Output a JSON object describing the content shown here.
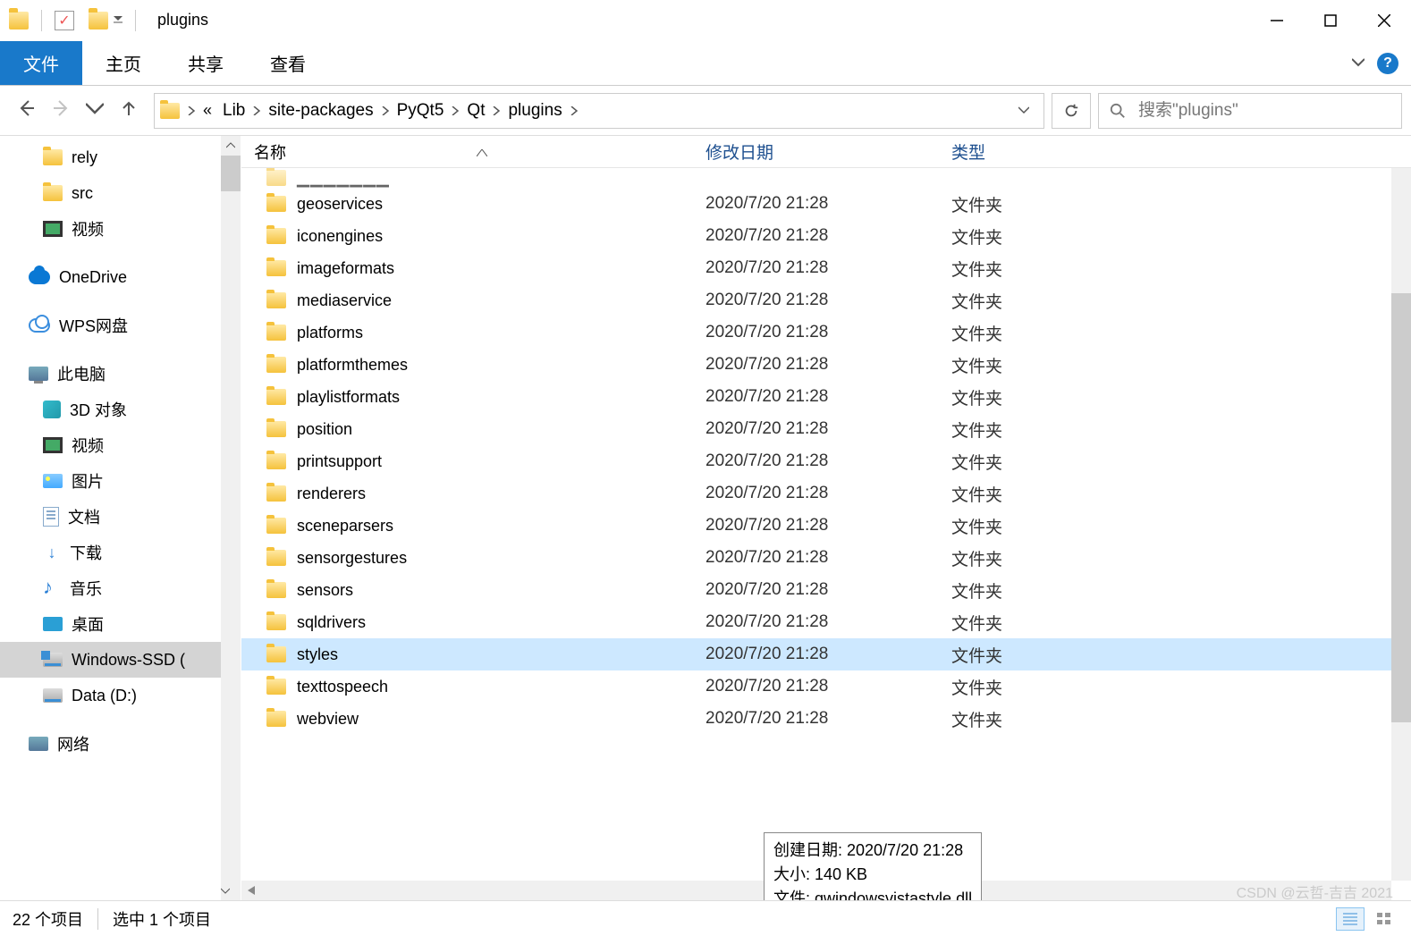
{
  "title": "plugins",
  "ribbon": {
    "file": "文件",
    "home": "主页",
    "share": "共享",
    "view": "查看"
  },
  "breadcrumb": [
    "Lib",
    "site-packages",
    "PyQt5",
    "Qt",
    "plugins"
  ],
  "search": {
    "placeholder": "搜索\"plugins\""
  },
  "columns": {
    "name": "名称",
    "date": "修改日期",
    "type": "类型"
  },
  "tree": [
    {
      "icon": "folder",
      "lvl": 2,
      "label": "rely"
    },
    {
      "icon": "folder",
      "lvl": 2,
      "label": "src"
    },
    {
      "icon": "video",
      "lvl": 2,
      "label": "视频"
    },
    {
      "icon": "onedrive",
      "lvl": 1,
      "label": "OneDrive",
      "gap": true
    },
    {
      "icon": "wps",
      "lvl": 1,
      "label": "WPS网盘",
      "gap": true
    },
    {
      "icon": "pc",
      "lvl": 1,
      "label": "此电脑",
      "gap": true
    },
    {
      "icon": "3d",
      "lvl": 2,
      "label": "3D 对象"
    },
    {
      "icon": "video",
      "lvl": 2,
      "label": "视频"
    },
    {
      "icon": "pic",
      "lvl": 2,
      "label": "图片"
    },
    {
      "icon": "doc",
      "lvl": 2,
      "label": "文档"
    },
    {
      "icon": "dl",
      "lvl": 2,
      "label": "下载"
    },
    {
      "icon": "music",
      "lvl": 2,
      "label": "音乐"
    },
    {
      "icon": "desk",
      "lvl": 2,
      "label": "桌面"
    },
    {
      "icon": "diskwin",
      "lvl": 2,
      "label": "Windows-SSD (",
      "selected": true
    },
    {
      "icon": "disk",
      "lvl": 2,
      "label": "Data (D:)"
    },
    {
      "icon": "net",
      "lvl": 1,
      "label": "网络",
      "gap": true
    }
  ],
  "files": [
    {
      "name": "geoservices",
      "date": "2020/7/20 21:28",
      "type": "文件夹"
    },
    {
      "name": "iconengines",
      "date": "2020/7/20 21:28",
      "type": "文件夹"
    },
    {
      "name": "imageformats",
      "date": "2020/7/20 21:28",
      "type": "文件夹"
    },
    {
      "name": "mediaservice",
      "date": "2020/7/20 21:28",
      "type": "文件夹"
    },
    {
      "name": "platforms",
      "date": "2020/7/20 21:28",
      "type": "文件夹"
    },
    {
      "name": "platformthemes",
      "date": "2020/7/20 21:28",
      "type": "文件夹"
    },
    {
      "name": "playlistformats",
      "date": "2020/7/20 21:28",
      "type": "文件夹"
    },
    {
      "name": "position",
      "date": "2020/7/20 21:28",
      "type": "文件夹"
    },
    {
      "name": "printsupport",
      "date": "2020/7/20 21:28",
      "type": "文件夹"
    },
    {
      "name": "renderers",
      "date": "2020/7/20 21:28",
      "type": "文件夹"
    },
    {
      "name": "sceneparsers",
      "date": "2020/7/20 21:28",
      "type": "文件夹"
    },
    {
      "name": "sensorgestures",
      "date": "2020/7/20 21:28",
      "type": "文件夹"
    },
    {
      "name": "sensors",
      "date": "2020/7/20 21:28",
      "type": "文件夹"
    },
    {
      "name": "sqldrivers",
      "date": "2020/7/20 21:28",
      "type": "文件夹"
    },
    {
      "name": "styles",
      "date": "2020/7/20 21:28",
      "type": "文件夹",
      "selected": true
    },
    {
      "name": "texttospeech",
      "date": "2020/7/20 21:28",
      "type": "文件夹"
    },
    {
      "name": "webview",
      "date": "2020/7/20 21:28",
      "type": "文件夹"
    }
  ],
  "tooltip": {
    "line1": "创建日期: 2020/7/20 21:28",
    "line2": "大小: 140 KB",
    "line3": "文件: qwindowsvistastyle.dll"
  },
  "status": {
    "count": "22 个项目",
    "selected": "选中 1 个项目"
  },
  "watermark": "CSDN @云哲-吉吉 2021"
}
